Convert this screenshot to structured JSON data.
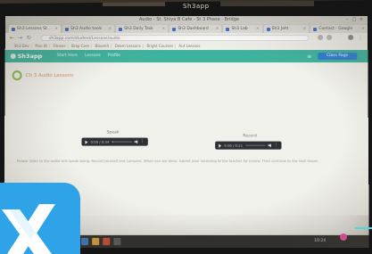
{
  "photo": {
    "monitor_top_label": "Sh3app"
  },
  "browser": {
    "window_title": "Audio - St. Shiya B Cafe - St 3 Phase - Bridge",
    "tabs": [
      {
        "label": "Sh3 Lessons St..."
      },
      {
        "label": "Sh3 Audio tools"
      },
      {
        "label": "Sh3 Daily Task"
      },
      {
        "label": "Sh3 Dashboard"
      },
      {
        "label": "Sh3 Lab"
      },
      {
        "label": "Sh3 Jeht"
      },
      {
        "label": "Contact - Google"
      }
    ],
    "address": "sh3app.com/student/Lessons/audio",
    "bookmarks": [
      "Sh3 Dev",
      "Plan Bl",
      "Fitness",
      "Brap Core",
      "Bloomit",
      "Deem Lessons",
      "Bright Courses",
      "Aut Lessons"
    ]
  },
  "app": {
    "brand": "Sh3app",
    "nav": [
      "Start Here",
      "Lessons",
      "Profile"
    ],
    "menu_icon": "hamburger-icon",
    "top_button": "Class Page"
  },
  "page": {
    "heading": "Ch 3 Audio Lessons",
    "players": [
      {
        "label": "Speak",
        "time": "0:00 / 0:34",
        "progress": 0.02
      },
      {
        "label": "Record",
        "time": "0:00 / 0:21",
        "progress": 0.0
      }
    ],
    "paragraph": "Please listen to the audio and speak along. Record yourself and compare. When you are done, submit your recording to the teacher for review. Then continue to the next lesson."
  },
  "taskbar": {
    "tray_time": "10:24"
  },
  "colors": {
    "appbar": "#3fb39f",
    "accent_button": "#2f7fd0",
    "heading": "#d98b5a",
    "ring": "#8ab94f",
    "player": "#2d3135",
    "overlay_icon": "#2fa3e8"
  }
}
